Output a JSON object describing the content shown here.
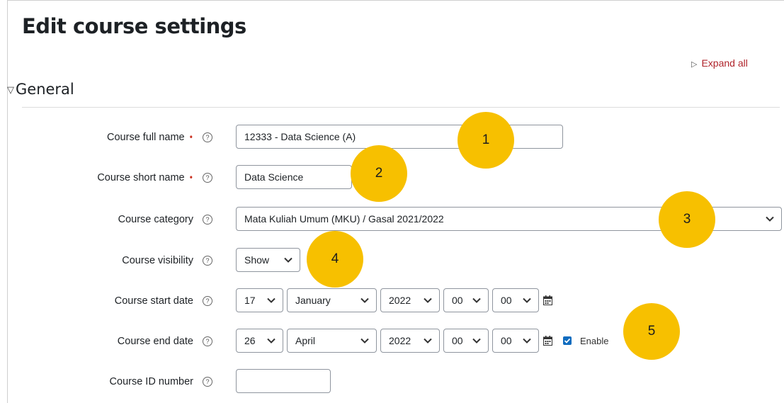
{
  "page": {
    "title": "Edit course settings",
    "expand_all": "Expand all",
    "section_title": "General"
  },
  "fields": {
    "full_name": {
      "label": "Course full name",
      "value": "12333 - Data Science (A)",
      "required": "•"
    },
    "short_name": {
      "label": "Course short name",
      "value": "Data Science",
      "required": "•"
    },
    "category": {
      "label": "Course category",
      "selected": "Mata Kuliah Umum (MKU) / Gasal 2021/2022"
    },
    "visibility": {
      "label": "Course visibility",
      "selected": "Show"
    },
    "start_date": {
      "label": "Course start date",
      "day": "17",
      "month": "January",
      "year": "2022",
      "hour": "00",
      "minute": "00"
    },
    "end_date": {
      "label": "Course end date",
      "day": "26",
      "month": "April",
      "year": "2022",
      "hour": "00",
      "minute": "00",
      "enable_label": "Enable",
      "enabled": true
    },
    "id_number": {
      "label": "Course ID number",
      "value": ""
    }
  },
  "help_icon_glyph": "?",
  "callouts": [
    "1",
    "2",
    "3",
    "4",
    "5"
  ],
  "colors": {
    "callout": "#f7c000",
    "link": "#b0242b",
    "required": "#ca3120",
    "checkbox": "#0f6cbf"
  }
}
